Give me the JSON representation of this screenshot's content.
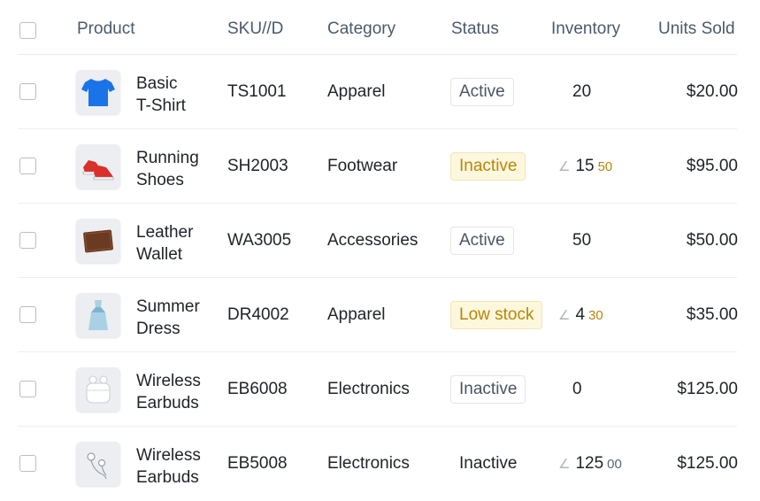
{
  "header": {
    "product": "Product",
    "sku": "SKU//D",
    "category": "Category",
    "status": "Status",
    "inventory": "Inventory",
    "units_sold": "Units Sold"
  },
  "rows": [
    {
      "name_line1": "Basic",
      "name_line2": "T-Shirt",
      "sku": "TS1001",
      "category": "Apparel",
      "status": "Active",
      "status_style": "neutral",
      "inv_icon": "",
      "inventory": "20",
      "inv_sub": "",
      "price": "$20.00",
      "thumb": "tshirt-icon"
    },
    {
      "name_line1": "Running",
      "name_line2": "Shoes",
      "sku": "SH2003",
      "category": "Footwear",
      "status": "Inactive",
      "status_style": "warning",
      "inv_icon": "∠",
      "inventory": "15",
      "inv_sub": "50",
      "price": "$95.00",
      "thumb": "shoes-icon"
    },
    {
      "name_line1": "Leather",
      "name_line2": "Wallet",
      "sku": "WA3005",
      "category": "Accessories",
      "status": "Active",
      "status_style": "neutral",
      "inv_icon": "",
      "inventory": "50",
      "inv_sub": "",
      "price": "$50.00",
      "thumb": "wallet-icon"
    },
    {
      "name_line1": "Summer",
      "name_line2": "Dress",
      "sku": "DR4002",
      "category": "Apparel",
      "status": "Low stock",
      "status_style": "warning",
      "inv_icon": "∠",
      "inventory": "4",
      "inv_sub": "30",
      "price": "$35.00",
      "thumb": "dress-icon"
    },
    {
      "name_line1": "Wireless",
      "name_line2": "Earbuds",
      "sku": "EB6008",
      "category": "Electronics",
      "status": "Inactive",
      "status_style": "neutral",
      "inv_icon": "",
      "inventory": "0",
      "inv_sub": "",
      "price": "$125.00",
      "thumb": "earbuds-case-icon"
    },
    {
      "name_line1": "Wireless",
      "name_line2": "Earbuds",
      "sku": "EB5008",
      "category": "Electronics",
      "status": "Inactive",
      "status_style": "plain",
      "inv_icon": "∠",
      "inventory": "125",
      "inv_sub": "00",
      "price": "$125.00",
      "thumb": "earbuds-icon"
    }
  ],
  "colors": {
    "warning_text": "#b8860b",
    "warning_bg": "#fdf7dd",
    "header_text": "#4a5a6d",
    "tshirt": "#1a73e8",
    "shoe": "#d9302c",
    "wallet": "#6b3a22"
  }
}
